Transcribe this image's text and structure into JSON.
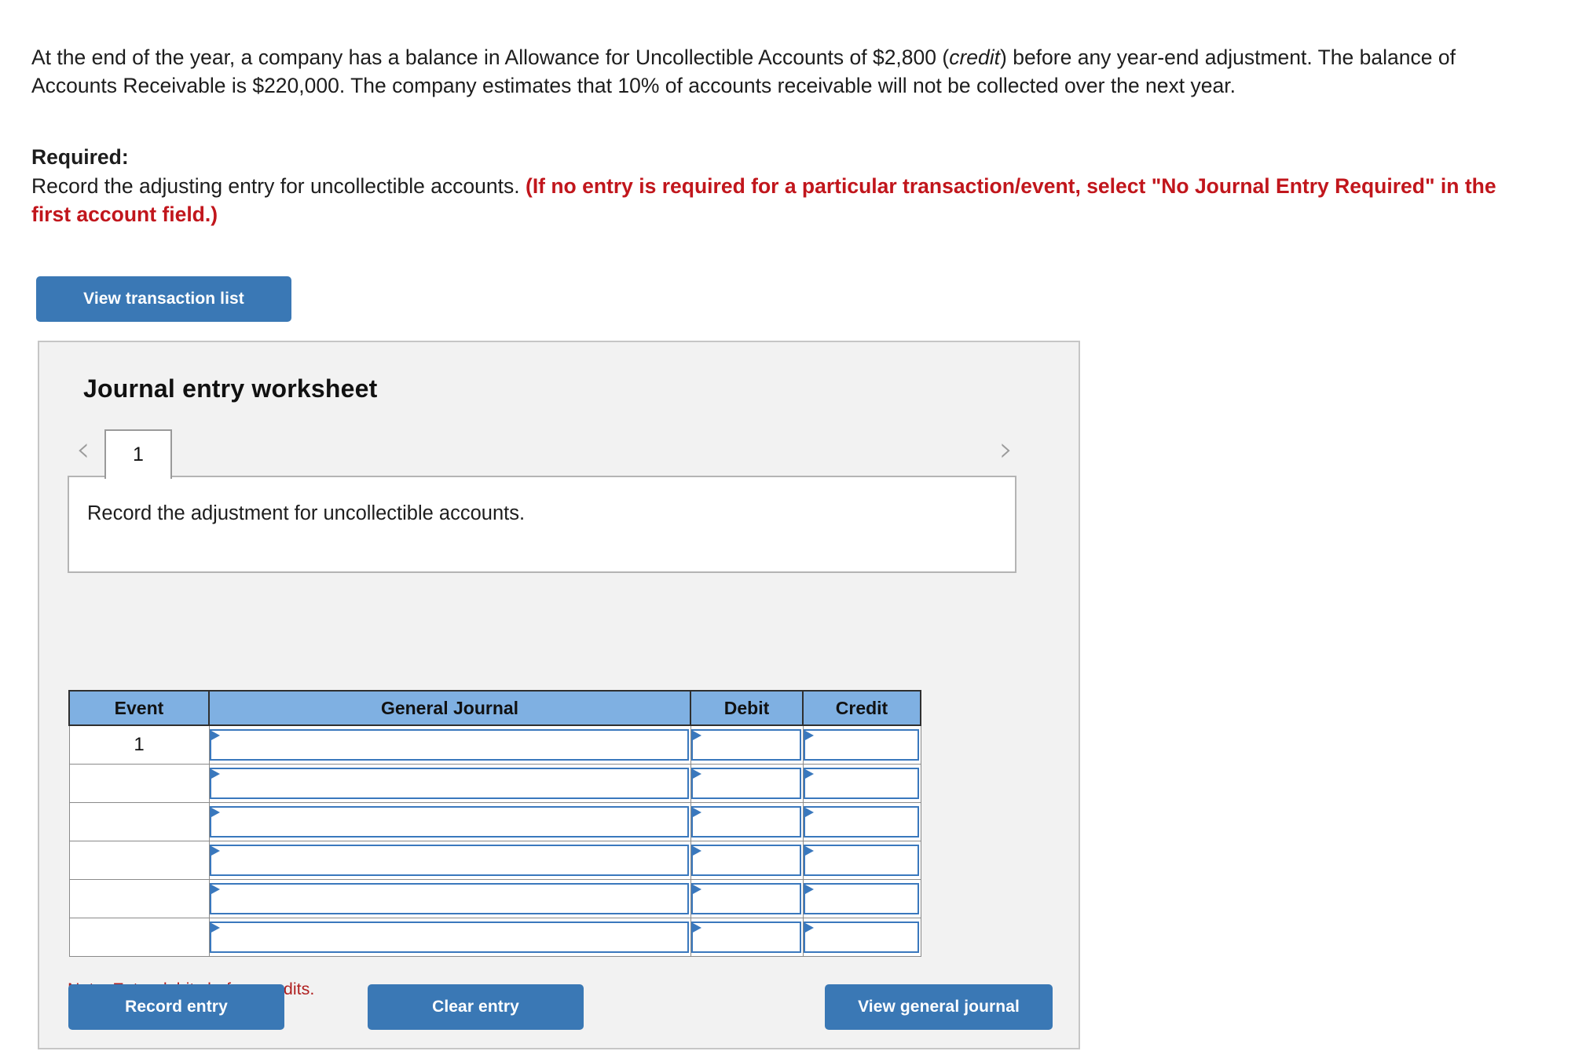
{
  "problem": {
    "part1": "At the end of the year, a company has a balance in Allowance for Uncollectible Accounts of $2,800 (",
    "italic": "credit",
    "part2": ") before any year-end adjustment. The balance of Accounts Receivable is $220,000. The company estimates that 10% of accounts receivable will not be collected over the next year."
  },
  "required": {
    "label": "Required:",
    "instruction": "Record the adjusting entry for uncollectible accounts. ",
    "emphasis": "(If no entry is required for a particular transaction/event, select \"No Journal Entry Required\" in the first account field.)"
  },
  "buttons": {
    "view_transaction_list": "View transaction list",
    "record_entry": "Record entry",
    "clear_entry": "Clear entry",
    "view_general_journal": "View general journal"
  },
  "worksheet": {
    "title": "Journal entry worksheet",
    "prev_arrow": "‹",
    "next_arrow": "›",
    "tabs": [
      {
        "label": "1",
        "active": true
      }
    ],
    "description": "Record the adjustment for uncollectible accounts.",
    "note": "Note: Enter debits before credits."
  },
  "journal_table": {
    "columns": [
      "Event",
      "General Journal",
      "Debit",
      "Credit"
    ],
    "rows": [
      {
        "event": "1",
        "general_journal": "",
        "debit": "",
        "credit": ""
      },
      {
        "event": "",
        "general_journal": "",
        "debit": "",
        "credit": ""
      },
      {
        "event": "",
        "general_journal": "",
        "debit": "",
        "credit": ""
      },
      {
        "event": "",
        "general_journal": "",
        "debit": "",
        "credit": ""
      },
      {
        "event": "",
        "general_journal": "",
        "debit": "",
        "credit": ""
      },
      {
        "event": "",
        "general_journal": "",
        "debit": "",
        "credit": ""
      }
    ]
  },
  "colors": {
    "primary_button": "#3a78b5",
    "table_header": "#7fb0e2",
    "field_border": "#3a78bd",
    "alert_red": "#c1161c",
    "note_red": "#b02020",
    "panel_bg": "#f2f2f2"
  }
}
